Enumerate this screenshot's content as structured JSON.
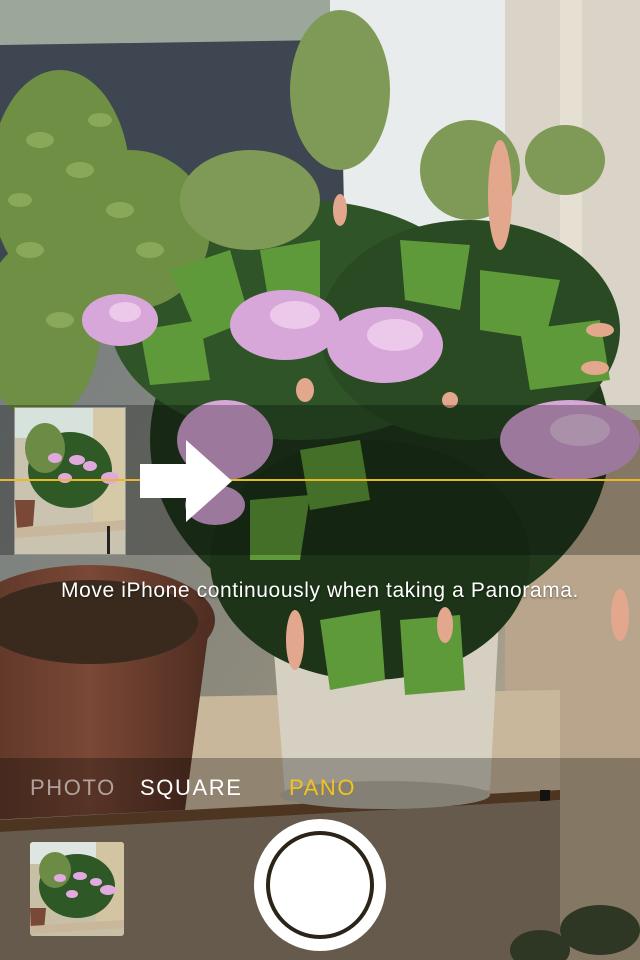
{
  "camera": {
    "hint_text": "Move iPhone continuously when taking a Panorama.",
    "modes": [
      {
        "label": "PHOTO",
        "state": "dimmed"
      },
      {
        "label": "SQUARE",
        "state": "normal"
      },
      {
        "label": "PANO",
        "state": "selected"
      }
    ],
    "accent_color": "#f2c21e",
    "guide_color": "#e8b82a",
    "icons": {
      "pano_arrow": "right-arrow-icon",
      "shutter": "shutter-button",
      "thumbnail": "last-photo-thumbnail"
    }
  }
}
